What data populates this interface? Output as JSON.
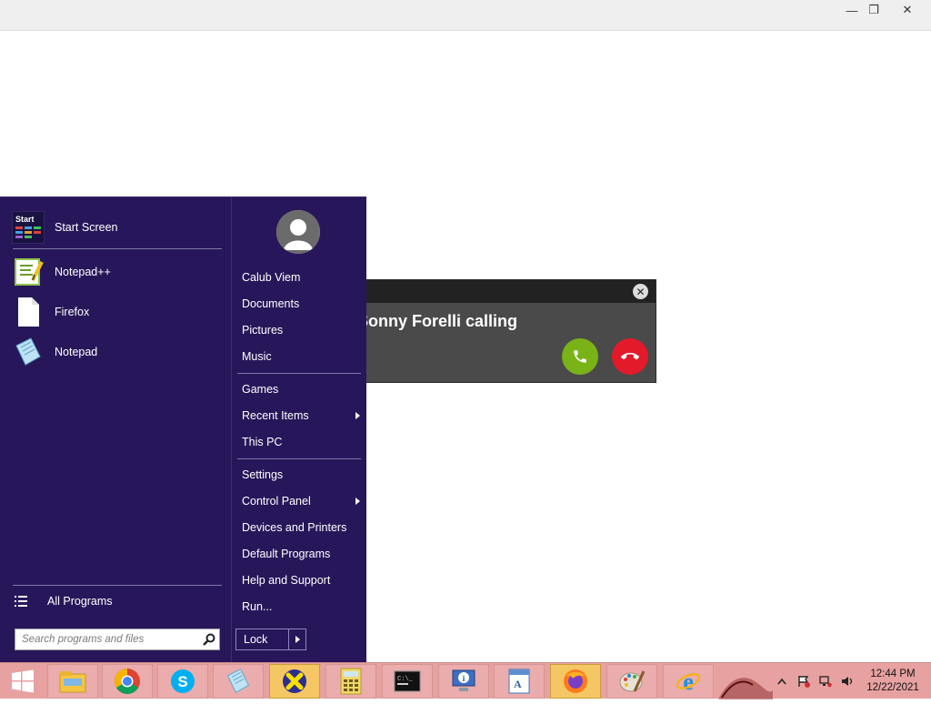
{
  "window": {
    "minimize_glyph": "—",
    "restore_glyph": "❐",
    "close_glyph": "✕"
  },
  "call_popup": {
    "caller_text": "Sonny Forelli calling",
    "close_glyph": "✕",
    "accept_color": "#7ab317",
    "decline_color": "#e31a2a"
  },
  "start_menu": {
    "pinned": [
      {
        "label": "Start Screen",
        "icon": "start-screen-icon"
      },
      {
        "label": "Notepad++",
        "icon": "notepad-plus-plus-icon"
      },
      {
        "label": "Firefox",
        "icon": "blank-document-icon"
      },
      {
        "label": "Notepad",
        "icon": "notepad-icon"
      }
    ],
    "all_programs_label": "All Programs",
    "search_placeholder": "Search programs and files",
    "right_items": [
      {
        "label": "Calub Viem"
      },
      {
        "label": "Documents"
      },
      {
        "label": "Pictures"
      },
      {
        "label": "Music"
      },
      {
        "label": "Games"
      },
      {
        "label": "Recent Items",
        "submenu": true
      },
      {
        "label": "This PC"
      },
      {
        "label": "Settings"
      },
      {
        "label": "Control Panel",
        "submenu": true
      },
      {
        "label": "Devices and Printers"
      },
      {
        "label": "Default Programs"
      },
      {
        "label": "Help and Support"
      },
      {
        "label": "Run..."
      }
    ],
    "lock_label": "Lock",
    "background_color": "#27175a"
  },
  "taskbar": {
    "apps": [
      "file-explorer-icon",
      "chrome-icon",
      "skype-icon",
      "notepad-icon",
      "xbox-icon",
      "calculator-icon",
      "command-prompt-icon",
      "system-info-icon",
      "wordpad-icon",
      "firefox-icon",
      "paint-icon",
      "internet-explorer-icon"
    ],
    "time": "12:44 PM",
    "date": "12/22/2021",
    "color": "#e7a1a1"
  }
}
